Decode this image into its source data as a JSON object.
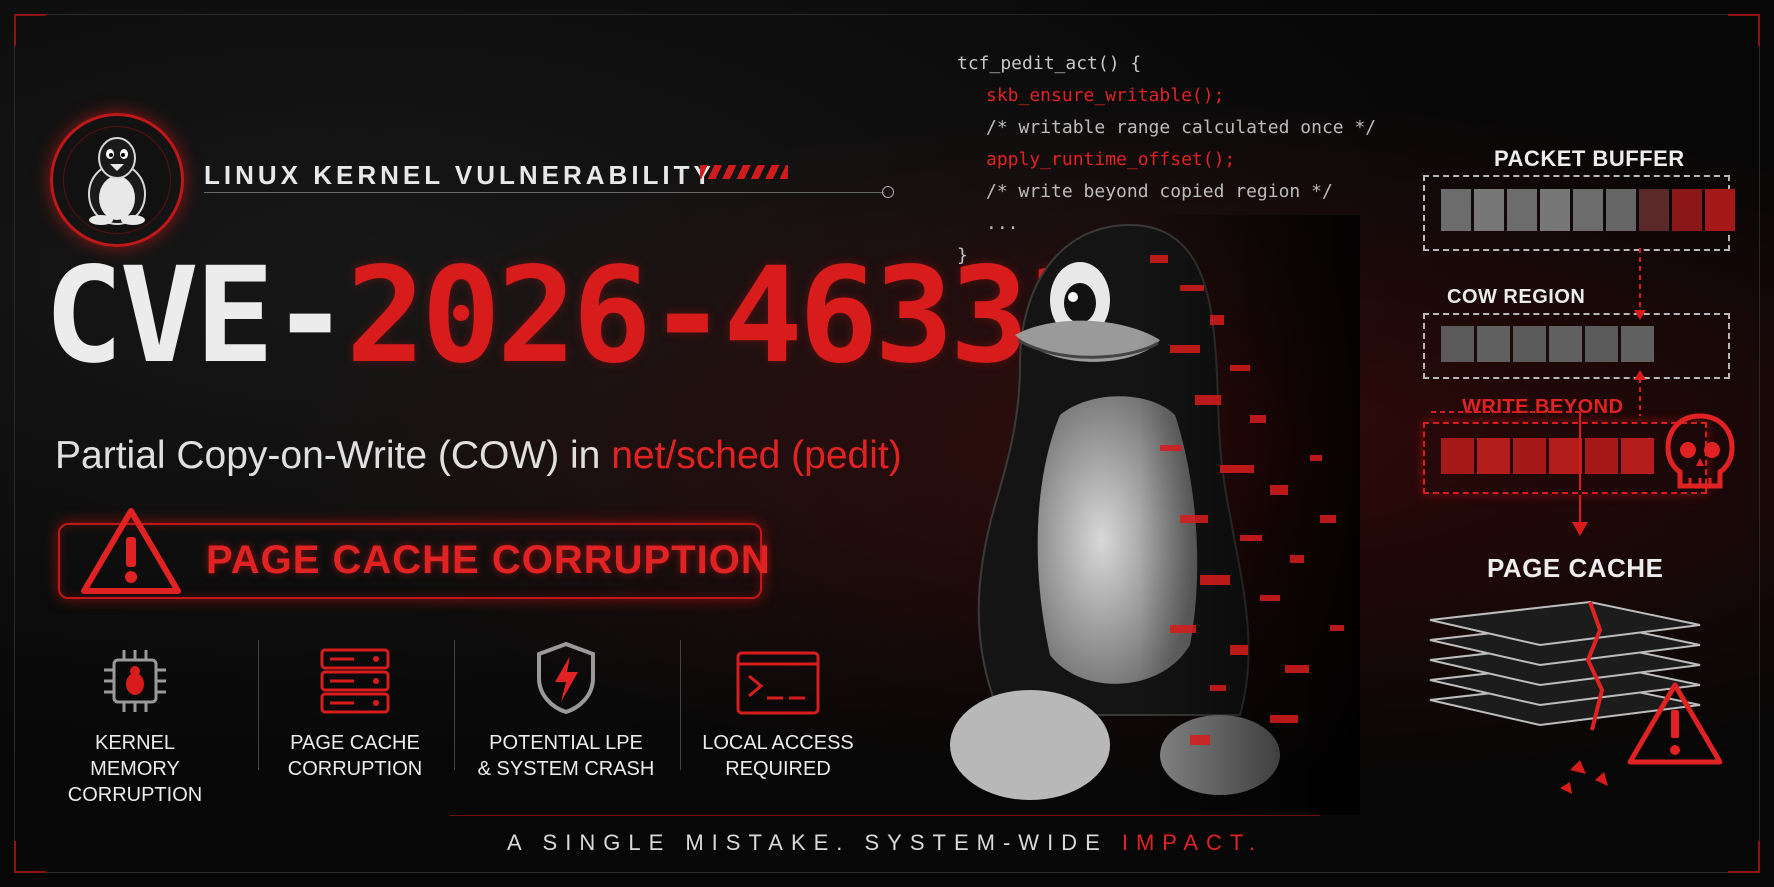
{
  "header": {
    "kicker": "LINUX KERNEL VULNERABILITY",
    "cve_prefix": "CVE-",
    "cve_number": "2026-46331",
    "subtitle_plain": "Partial Copy-on-Write (COW) in ",
    "subtitle_highlight": "net/sched (pedit)"
  },
  "alert": {
    "label": "PAGE CACHE CORRUPTION",
    "icon": "warning-triangle-icon"
  },
  "features": [
    {
      "icon": "chip-bug-icon",
      "line1": "KERNEL",
      "line2": "MEMORY CORRUPTION"
    },
    {
      "icon": "server-stack-icon",
      "line1": "PAGE CACHE",
      "line2": "CORRUPTION"
    },
    {
      "icon": "shield-lightning-icon",
      "line1": "POTENTIAL LPE",
      "line2": "& SYSTEM CRASH"
    },
    {
      "icon": "terminal-icon",
      "line1": "LOCAL ACCESS",
      "line2": "REQUIRED"
    }
  ],
  "code": {
    "line1": "tcf_pedit_act() {",
    "line2": "skb_ensure_writable();",
    "line3": "/* writable range calculated once */",
    "line4": "apply_runtime_offset();",
    "line5": "/* write beyond copied region */",
    "line6": "...",
    "line7": "}"
  },
  "diagram": {
    "packet_buffer": "PACKET BUFFER",
    "cow_region": "COW REGION",
    "write_beyond": "WRITE BEYOND",
    "page_cache": "PAGE CACHE"
  },
  "footer": {
    "text_plain": "A SINGLE MISTAKE. SYSTEM-WIDE ",
    "text_highlight": "IMPACT."
  },
  "colors": {
    "accent_red": "#d81c1c",
    "background": "#070707",
    "text": "#e8e8e8"
  }
}
